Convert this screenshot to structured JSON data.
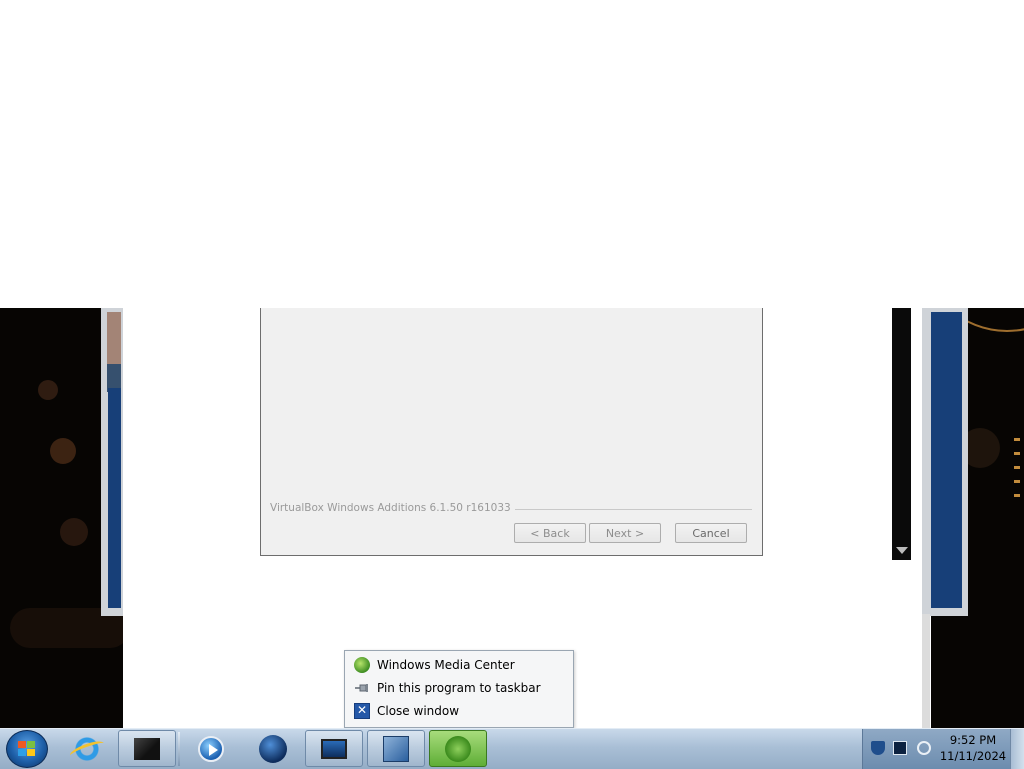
{
  "dialog": {
    "brand": "VirtualBox Windows Additions 6.1.50 r161033",
    "buttons": {
      "back": "< Back",
      "next": "Next >",
      "cancel": "Cancel"
    }
  },
  "jump_menu": {
    "items": [
      {
        "label": "Windows Media Center",
        "icon": "windows-media-center-icon"
      },
      {
        "label": "Pin this program to taskbar",
        "icon": "pin-icon"
      },
      {
        "label": "Close window",
        "icon": "close-window-icon"
      }
    ]
  },
  "taskbar": {
    "buttons": [
      {
        "icon": "start-orb-icon"
      },
      {
        "icon": "internet-explorer-icon"
      },
      {
        "icon": "black-box-app-icon"
      },
      {
        "icon": "media-player-icon"
      },
      {
        "icon": "globe-icon"
      },
      {
        "icon": "monitor-app-icon"
      },
      {
        "icon": "virtualbox-icon"
      },
      {
        "icon": "windows-media-center-icon",
        "active": true
      }
    ],
    "tray": {
      "icons": [
        "security-shield-icon",
        "network-icon",
        "volume-icon"
      ]
    },
    "clock": {
      "time": "9:52 PM",
      "date": "11/11/2024"
    }
  }
}
